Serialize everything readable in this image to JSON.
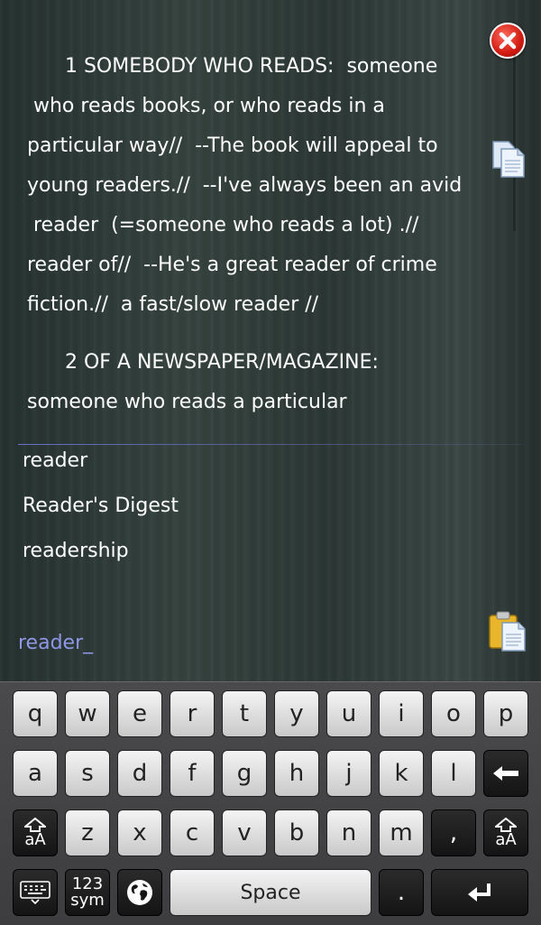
{
  "definition": {
    "sense1_lines": [
      "      1 SOMEBODY WHO READS:  someone",
      " who reads books, or who reads in a",
      "particular way//  --The book will appeal to",
      "young readers.//  --I've always been an avid",
      " reader  (=someone who reads a lot) .//",
      "reader of//  --He's a great reader of crime",
      "fiction.//  a fast/slow reader //"
    ],
    "sense2_lines": [
      "      2 OF A NEWSPAPER/MAGAZINE:",
      "someone who reads a particular"
    ]
  },
  "suggestions": [
    "reader",
    "Reader's Digest",
    "readership"
  ],
  "search": {
    "text": "reader_"
  },
  "keyboard": {
    "row1": [
      "q",
      "w",
      "e",
      "r",
      "t",
      "y",
      "u",
      "i",
      "o",
      "p"
    ],
    "row2": [
      "a",
      "s",
      "d",
      "f",
      "g",
      "h",
      "j",
      "k",
      "l"
    ],
    "row3": [
      "z",
      "x",
      "c",
      "v",
      "b",
      "n",
      "m"
    ],
    "comma": ",",
    "shift_label": "aA",
    "mode_label_top": "123",
    "mode_label_bottom": "sym",
    "space_label": "Space",
    "period": "."
  },
  "colors": {
    "accent": "#8f97e6",
    "close": "#d11b12"
  }
}
